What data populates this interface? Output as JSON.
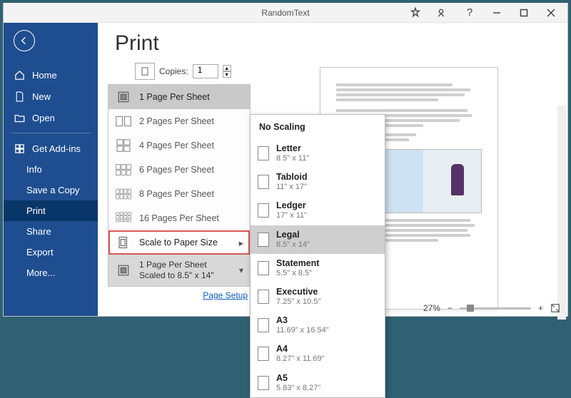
{
  "titlebar": {
    "title": "RandomText"
  },
  "sidebar": {
    "home": "Home",
    "new": "New",
    "open": "Open",
    "get_addins": "Get Add-ins",
    "info": "Info",
    "save_copy": "Save a Copy",
    "print": "Print",
    "share": "Share",
    "export": "Export",
    "more": "More..."
  },
  "page": {
    "title": "Print"
  },
  "copies": {
    "label": "Copies:",
    "value": "1"
  },
  "pps": {
    "opt1": "1 Page Per Sheet",
    "opt2": "2 Pages Per Sheet",
    "opt4": "4 Pages Per Sheet",
    "opt6": "6 Pages Per Sheet",
    "opt8": "8 Pages Per Sheet",
    "opt16": "16 Pages Per Sheet",
    "scale": "Scale to Paper Size",
    "summary_line1": "1 Page Per Sheet",
    "summary_line2": "Scaled to 8.5\" x 14\""
  },
  "page_setup": "Page Setup",
  "paper_flyout": {
    "header": "No Scaling",
    "items": [
      {
        "name": "Letter",
        "dims": "8.5\" x 11\""
      },
      {
        "name": "Tabloid",
        "dims": "11\" x 17\""
      },
      {
        "name": "Ledger",
        "dims": "17\" x 11\""
      },
      {
        "name": "Legal",
        "dims": "8.5\" x 14\""
      },
      {
        "name": "Statement",
        "dims": "5.5\" x 8.5\""
      },
      {
        "name": "Executive",
        "dims": "7.25\" x 10.5\""
      },
      {
        "name": "A3",
        "dims": "11.69\" x 16.54\""
      },
      {
        "name": "A4",
        "dims": "8.27\" x 11.69\""
      },
      {
        "name": "A5",
        "dims": "5.83\" x 8.27\""
      }
    ],
    "selected_index": 3
  },
  "zoom": {
    "value": "27%"
  }
}
